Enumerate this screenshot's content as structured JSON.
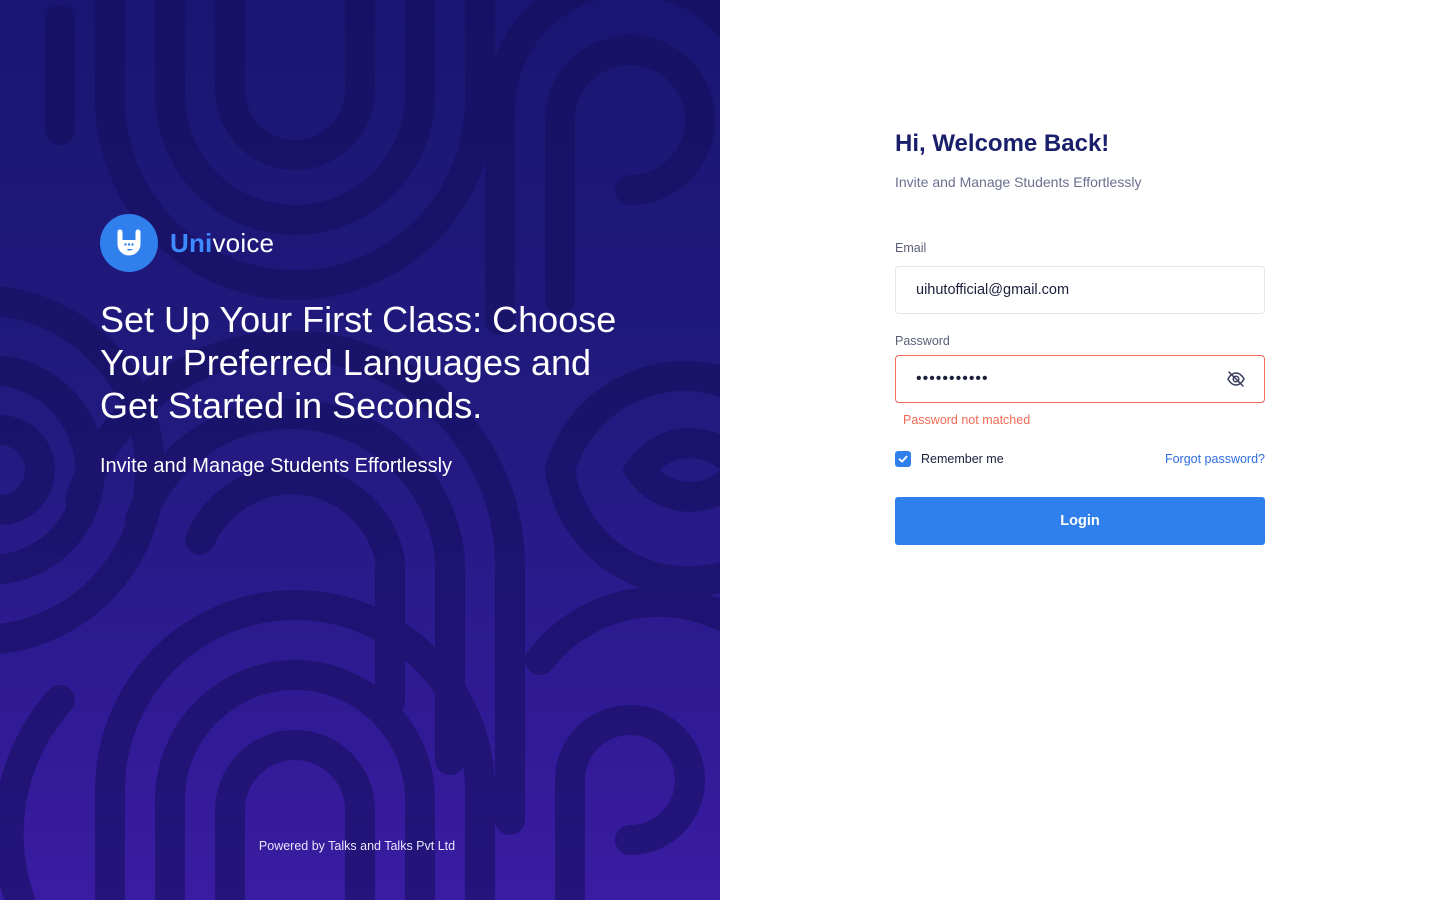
{
  "brand": {
    "name_accent": "Uni",
    "name_rest": "voice",
    "logo_icon": "speech-bubble-u-icon"
  },
  "hero": {
    "title": "Set Up Your First Class: Choose Your Preferred Languages and Get Started in Seconds.",
    "subtitle": "Invite and Manage Students Effortlessly"
  },
  "footer": {
    "powered_by": "Powered by Talks and Talks Pvt Ltd"
  },
  "login": {
    "heading": "Hi, Welcome Back!",
    "subheading": "Invite and Manage Students Effortlessly",
    "email": {
      "label": "Email",
      "value": "uihutofficial@gmail.com"
    },
    "password": {
      "label": "Password",
      "value": "•••••••••••",
      "toggle_icon": "eye-off-icon",
      "error": "Password not matched"
    },
    "remember_me": {
      "label": "Remember me",
      "checked": true
    },
    "forgot_password": "Forgot password?",
    "submit_label": "Login"
  },
  "colors": {
    "left_bg_top": "#1a1572",
    "left_bg_bottom": "#3a1ca2",
    "accent_blue": "#2f80ed",
    "heading_navy": "#1a1f6b",
    "error_red": "#f06a55"
  }
}
